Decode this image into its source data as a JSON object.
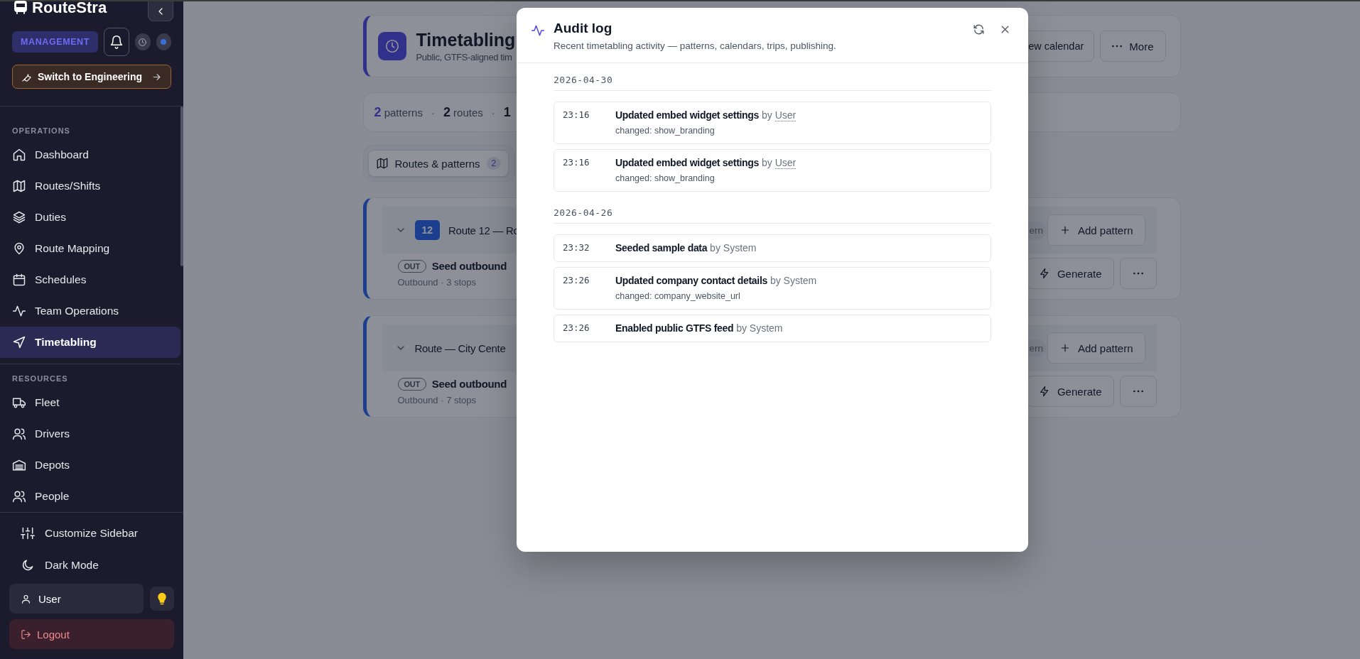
{
  "sidebar": {
    "brand": "RouteStra",
    "role_badge": "MANAGEMENT",
    "switch_button": "Switch to Engineering",
    "sections": [
      {
        "label": "OPERATIONS",
        "items": [
          {
            "label": "Dashboard",
            "selected": false
          },
          {
            "label": "Routes/Shifts",
            "selected": false
          },
          {
            "label": "Duties",
            "selected": false
          },
          {
            "label": "Route Mapping",
            "selected": false
          },
          {
            "label": "Schedules",
            "selected": false
          },
          {
            "label": "Team Operations",
            "selected": false
          },
          {
            "label": "Timetabling",
            "selected": true
          }
        ]
      },
      {
        "label": "RESOURCES",
        "items": [
          {
            "label": "Fleet",
            "selected": false
          },
          {
            "label": "Drivers",
            "selected": false
          },
          {
            "label": "Depots",
            "selected": false
          },
          {
            "label": "People",
            "selected": false
          }
        ]
      }
    ],
    "footer_items": [
      "Customize Sidebar",
      "Dark Mode"
    ],
    "user": "User",
    "logout": "Logout"
  },
  "page": {
    "title": "Timetabling",
    "subtitle": "Public, GTFS-aligned tim",
    "header_buttons": [
      {
        "label": "ew calendar",
        "kind": "plain"
      },
      {
        "label": "More",
        "kind": "more"
      }
    ],
    "stats": [
      {
        "count": "2",
        "unit": "patterns",
        "highlighted": true
      },
      {
        "separator": "·",
        "count": "2",
        "unit": "routes",
        "highlighted": false
      },
      {
        "separator": "·",
        "count": "1",
        "highlighted": false
      }
    ],
    "tabs": [
      {
        "label": "Routes & patterns",
        "count": "2",
        "selected": true
      }
    ],
    "routes": [
      {
        "badge": "12",
        "name": "Route 12 — Ro",
        "tag": "ern",
        "add_button": "Add pattern",
        "patterns": [
          {
            "direction": "OUT",
            "name": "Seed outbound",
            "meta": "Outbound · 3 stops",
            "generate": "Generate"
          }
        ]
      },
      {
        "name": "Route — City Cente",
        "tag": "ern",
        "add_button": "Add pattern",
        "patterns": [
          {
            "direction": "OUT",
            "name": "Seed outbound",
            "meta": "Outbound · 7 stops",
            "generate": "Generate"
          }
        ]
      }
    ]
  },
  "modal": {
    "title": "Audit log",
    "subtitle": "Recent timetabling activity — patterns, calendars, trips, publishing.",
    "groups": [
      {
        "date": "2026-04-30",
        "entries": [
          {
            "time": "23:16",
            "action": "Updated embed widget settings",
            "by": "by",
            "actor": "User",
            "linked": true,
            "detail": "changed: show_branding"
          },
          {
            "time": "23:16",
            "action": "Updated embed widget settings",
            "by": "by",
            "actor": "User",
            "linked": true,
            "detail": "changed: show_branding"
          }
        ]
      },
      {
        "date": "2026-04-26",
        "entries": [
          {
            "time": "23:32",
            "action": "Seeded sample data",
            "by": "by",
            "actor": "System",
            "linked": false
          },
          {
            "time": "23:26",
            "action": "Updated company contact details",
            "by": "by",
            "actor": "System",
            "linked": false,
            "detail": "changed: company_website_url"
          },
          {
            "time": "23:26",
            "action": "Enabled public GTFS feed",
            "by": "by",
            "actor": "System",
            "linked": false
          }
        ]
      }
    ]
  }
}
